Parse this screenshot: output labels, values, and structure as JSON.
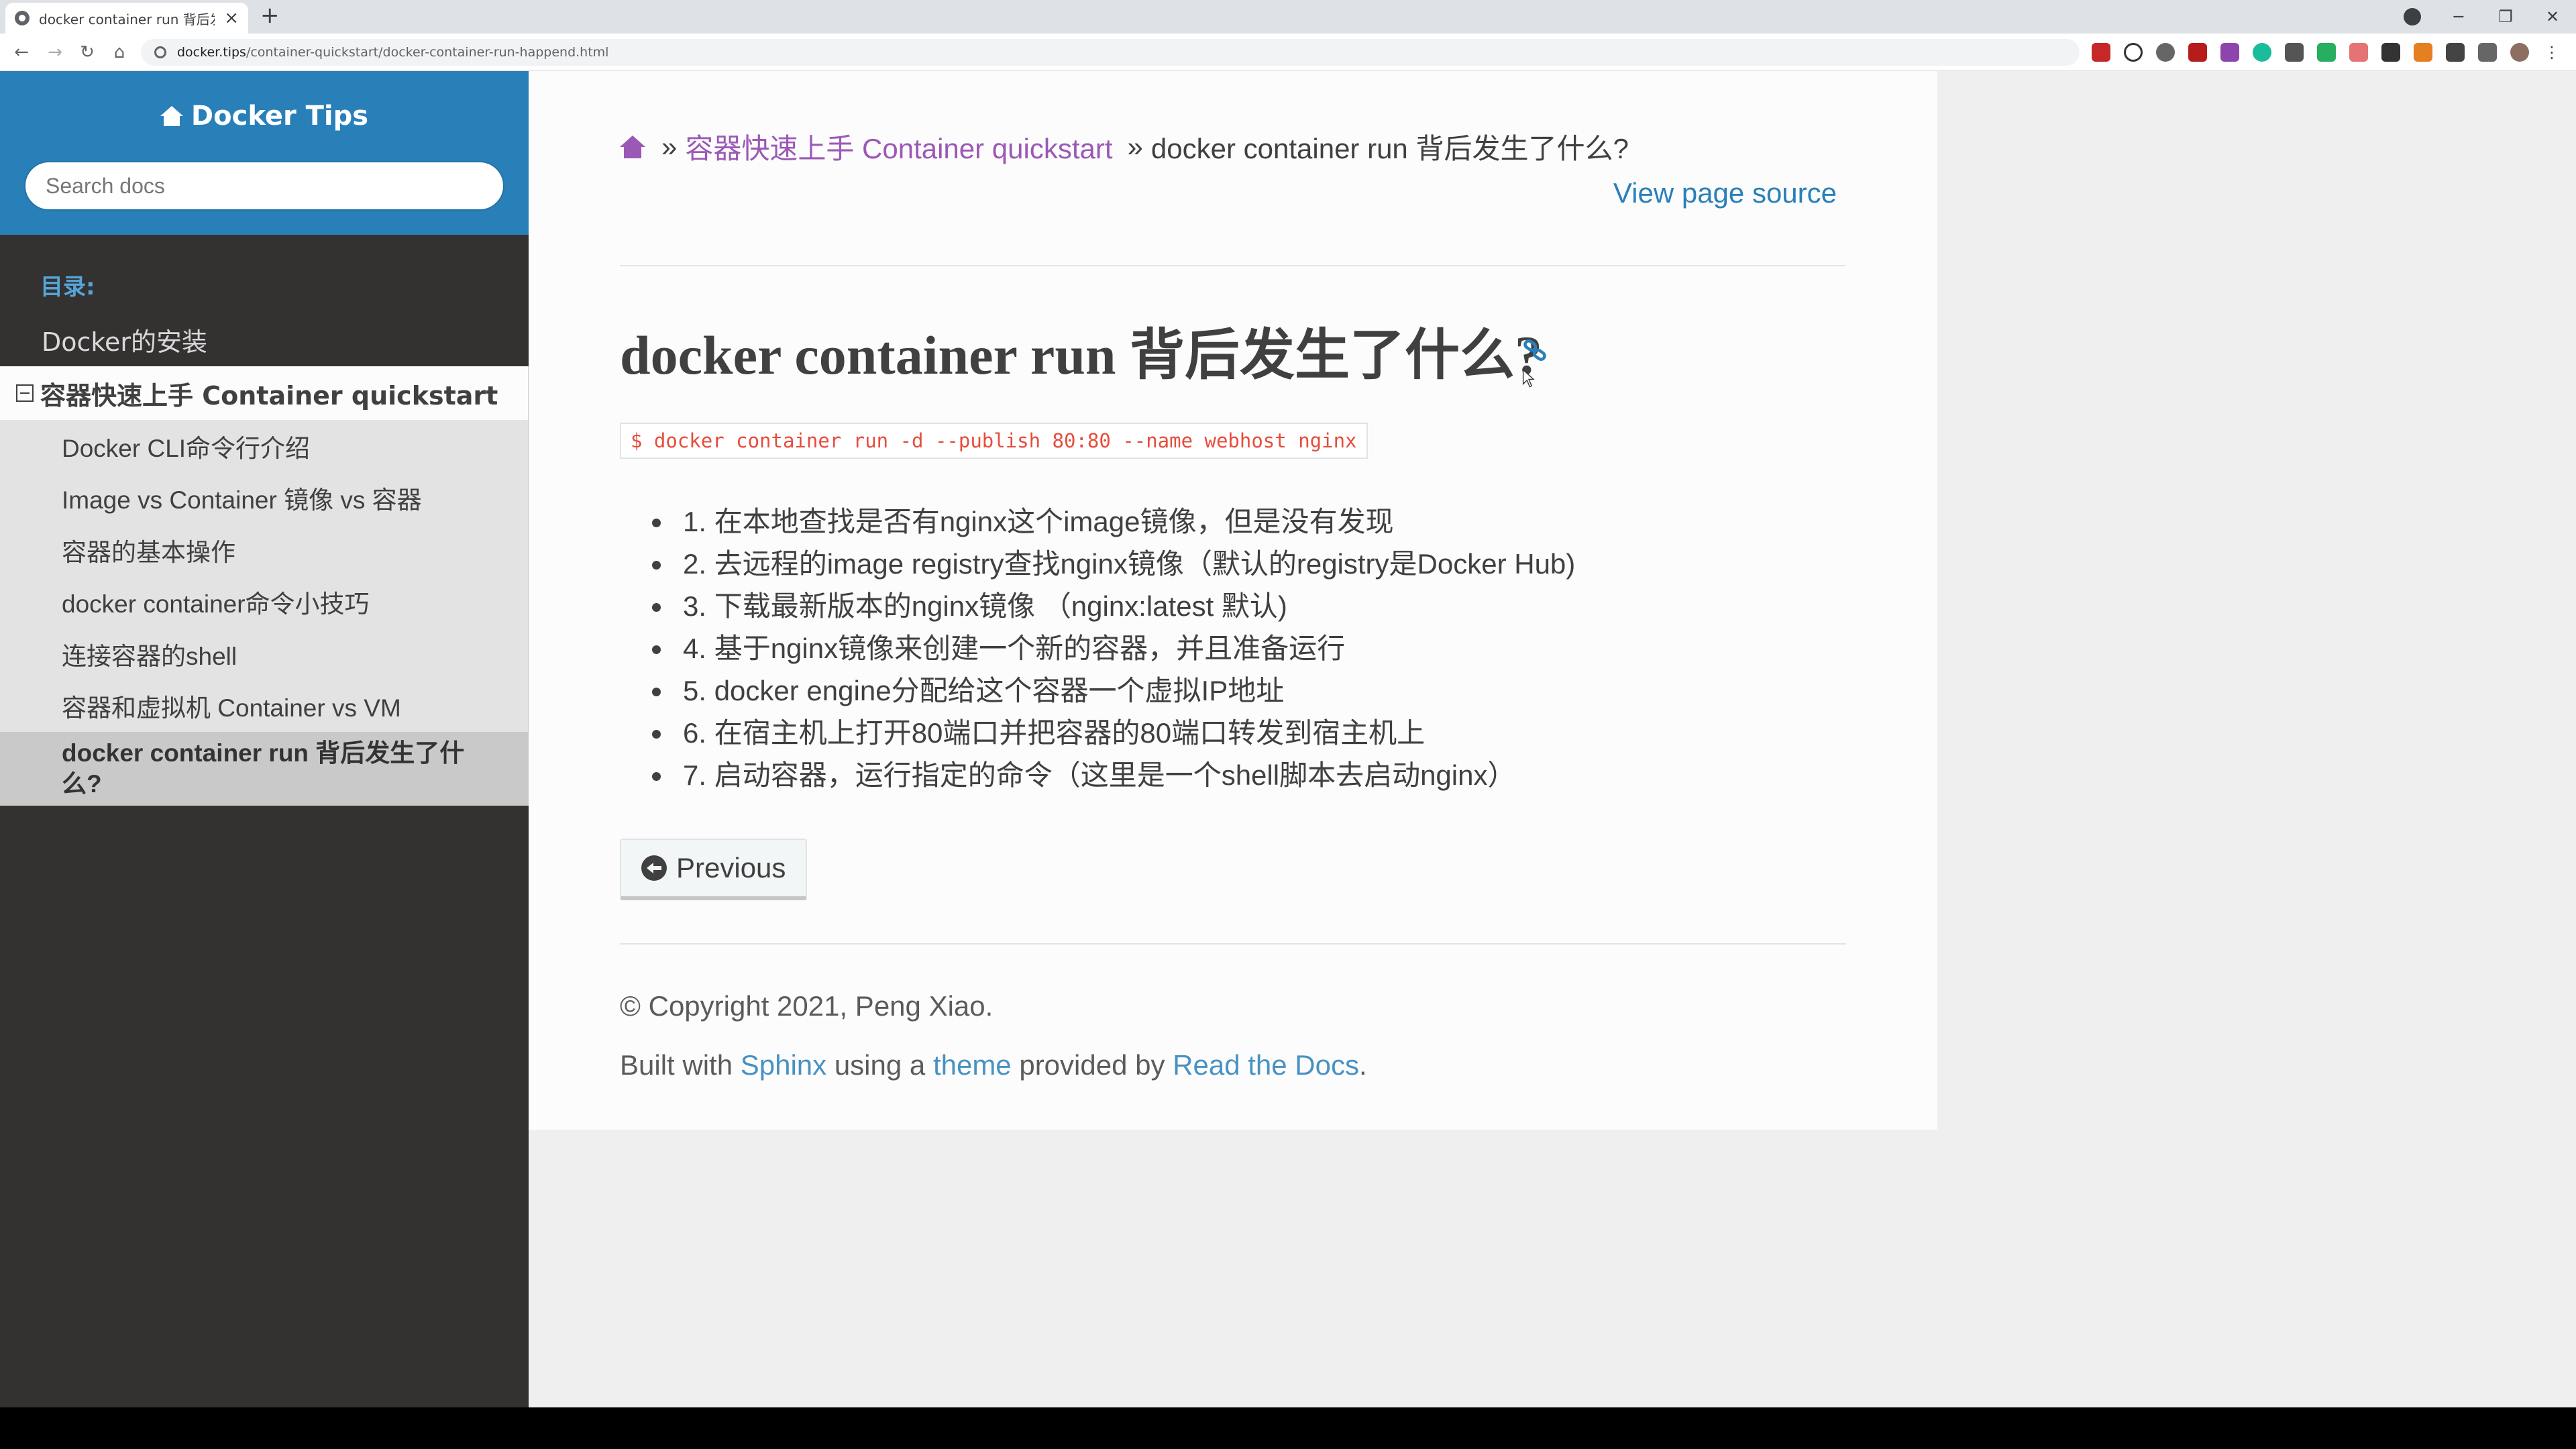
{
  "browser": {
    "tab_title": "docker container run 背后发生了什么",
    "tab_close": "×",
    "new_tab": "+",
    "url_host": "docker.tips",
    "url_path": "/container-quickstart/docker-container-run-happend.html",
    "window_controls": {
      "minimize": "─",
      "restore": "❐",
      "close": "✕"
    },
    "nav": {
      "back": "←",
      "forward": "→",
      "reload": "↻",
      "home": "⌂"
    }
  },
  "sidebar": {
    "site_title": "Docker Tips",
    "search_placeholder": "Search docs",
    "toc_caption": "目录:",
    "items": [
      {
        "label": "Docker的安装"
      },
      {
        "label": "容器快速上手 Container quickstart"
      }
    ],
    "subitems": [
      {
        "label": "Docker CLI命令行介绍"
      },
      {
        "label": "Image vs Container 镜像 vs 容器"
      },
      {
        "label": "容器的基本操作"
      },
      {
        "label": "docker container命令小技巧"
      },
      {
        "label": "连接容器的shell"
      },
      {
        "label": "容器和虚拟机 Container vs VM"
      },
      {
        "label": "docker container run 背后发生了什么?"
      }
    ]
  },
  "content": {
    "breadcrumb": {
      "sep": "»",
      "parent": "容器快速上手 Container quickstart",
      "current": "docker container run 背后发生了什么?"
    },
    "view_source": "View page source",
    "title": "docker container run 背后发生了什么?",
    "code": "$ docker container run -d --publish 80:80 --name webhost nginx",
    "steps": [
      "1. 在本地查找是否有nginx这个image镜像，但是没有发现",
      "2. 去远程的image registry查找nginx镜像（默认的registry是Docker Hub)",
      "3. 下载最新版本的nginx镜像 （nginx:latest 默认)",
      "4. 基于nginx镜像来创建一个新的容器，并且准备运行",
      "5. docker engine分配给这个容器一个虚拟IP地址",
      "6. 在宿主机上打开80端口并把容器的80端口转发到宿主机上",
      "7. 启动容器，运行指定的命令（这里是一个shell脚本去启动nginx）"
    ],
    "previous": "Previous",
    "copyright": "© Copyright 2021, Peng Xiao.",
    "built_with": {
      "t1": "Built with ",
      "sphinx": "Sphinx",
      "t2": " using a ",
      "theme": "theme",
      "t3": " provided by ",
      "rtd": "Read the Docs",
      "t4": "."
    }
  },
  "colors": {
    "sidebar_header": "#2980b9",
    "sidebar_bg": "#343131",
    "link": "#2980b9",
    "visited_link": "#9b59b6",
    "code_text": "#e74c3c",
    "toc_caption": "#55a5d9"
  },
  "icons": [
    "home-icon",
    "link-icon",
    "arrow-circle-left-icon",
    "lock-icon",
    "extension-icons"
  ]
}
